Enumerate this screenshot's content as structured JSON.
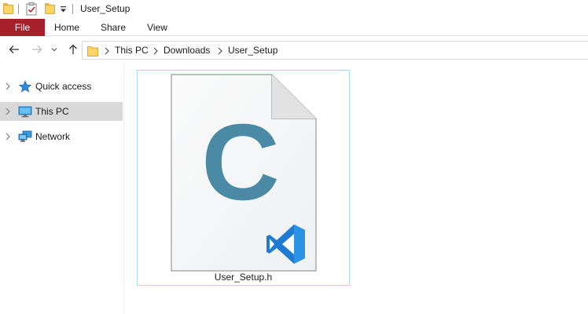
{
  "window": {
    "title": "User_Setup"
  },
  "quick_access_toolbar": {
    "icons": [
      "folder-icon",
      "properties-icon",
      "new-folder-icon",
      "customize-dropdown-icon"
    ]
  },
  "ribbon": {
    "tabs": [
      {
        "label": "File",
        "active": true
      },
      {
        "label": "Home"
      },
      {
        "label": "Share"
      },
      {
        "label": "View"
      }
    ]
  },
  "navigation": {
    "buttons": [
      "back-arrow-icon",
      "forward-arrow-icon",
      "recent-locations-icon",
      "up-arrow-icon"
    ],
    "breadcrumb": [
      "This PC",
      "Downloads",
      "User_Setup"
    ]
  },
  "sidebar": {
    "items": [
      {
        "label": "Quick access",
        "icon": "star-icon",
        "selected": false
      },
      {
        "label": "This PC",
        "icon": "computer-icon",
        "selected": true
      },
      {
        "label": "Network",
        "icon": "network-icon",
        "selected": false
      }
    ]
  },
  "files": [
    {
      "name": "User_Setup.h",
      "icon": "c-header-file-icon",
      "selected": true
    }
  ],
  "colors": {
    "file_tab": "#a5202a",
    "selected_nav": "#d9d9d9",
    "tile_border": "#a6dceb",
    "c_letter": "#4b8aa5",
    "vscode_blue": "#1f7ad1"
  }
}
